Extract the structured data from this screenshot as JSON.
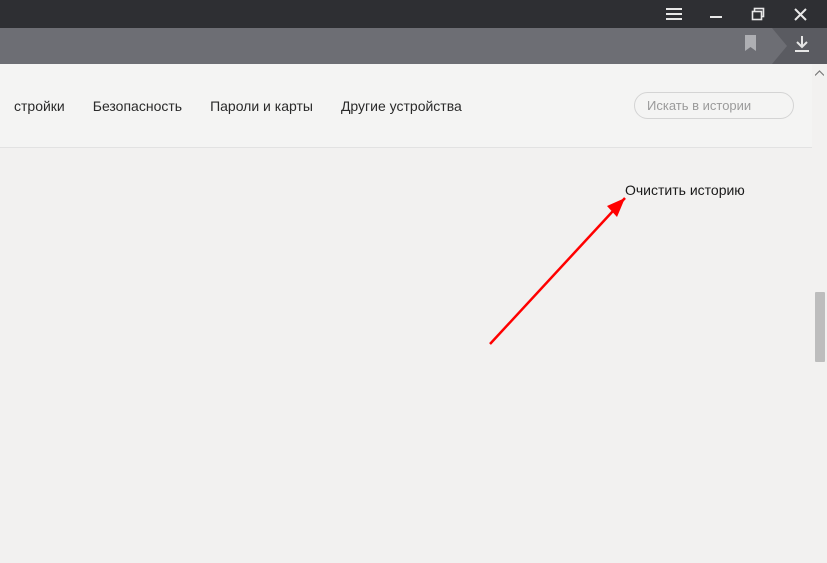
{
  "tabs": {
    "settings_fragment": "стройки",
    "security": "Безопасность",
    "passwords": "Пароли и карты",
    "other_devices": "Другие устройства"
  },
  "search": {
    "placeholder": "Искать в истории",
    "value": ""
  },
  "actions": {
    "clear_history": "Очистить историю"
  }
}
